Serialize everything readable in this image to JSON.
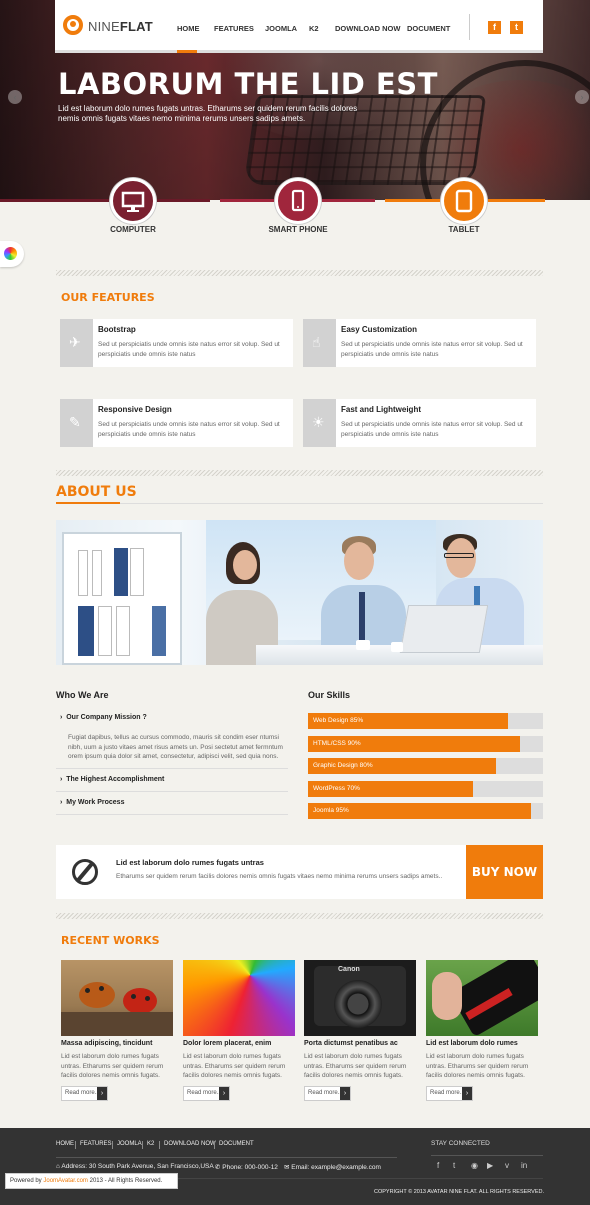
{
  "header": {
    "logo_prefix": "NINE",
    "logo_suffix": "FLAT",
    "nav": [
      "HOME",
      "FEATURES",
      "JOOMLA",
      "K2",
      "DOWNLOAD NOW",
      "DOCUMENT"
    ],
    "social_icons": [
      "facebook-icon",
      "twitter-icon"
    ]
  },
  "hero": {
    "title": "LABORUM THE LID EST",
    "subtitle": "Lid est laborum dolo rumes fugats untras. Etharums ser quidem rerum facilis dolores nemis omnis fugats vitaes nemo minima rerums unsers sadips amets.",
    "devices": [
      {
        "label": "COMPUTER",
        "icon": "monitor-icon",
        "color": "#7a2030"
      },
      {
        "label": "SMART PHONE",
        "icon": "smartphone-icon",
        "color": "#a0263c"
      },
      {
        "label": "TABLET",
        "icon": "tablet-icon",
        "color": "#f07c0c"
      }
    ]
  },
  "features": {
    "title": "OUR FEATURES",
    "items": [
      {
        "title": "Bootstrap",
        "text": "Sed ut perspiciatis unde omnis iste natus error sit volup. Sed ut perspiciatis unde omnis iste natus",
        "icon": "paper-plane-icon"
      },
      {
        "title": "Easy Customization",
        "text": "Sed ut perspiciatis unde omnis iste natus error sit volup. Sed ut perspiciatis unde omnis iste natus",
        "icon": "touch-icon"
      },
      {
        "title": "Responsive Design",
        "text": "Sed ut perspiciatis unde omnis iste natus error sit volup. Sed ut perspiciatis unde omnis iste natus",
        "icon": "brush-icon"
      },
      {
        "title": "Fast and Lightweight",
        "text": "Sed ut perspiciatis unde omnis iste natus error sit volup. Sed ut perspiciatis unde omnis iste natus",
        "icon": "lightbulb-icon"
      }
    ]
  },
  "about": {
    "title": "ABOUT US",
    "who_title": "Who We Are",
    "skills_title": "Our Skills",
    "accordion": [
      {
        "label": "Our Company Mission ?",
        "open": true,
        "text": "Fugiat dapibus, tellus ac cursus commodo, mauris sit condim eser ntumsi nibh, uum a justo vitaes amet risus amets un. Posi sectetut amet fermntum orem ipsum quia dolor sit amet, consectetur, adipisci velit, sed quia nons."
      },
      {
        "label": "The Highest Accomplishment",
        "open": false
      },
      {
        "label": "My Work Process",
        "open": false
      }
    ],
    "skills": [
      {
        "label": "Web Design 85%",
        "value": 85
      },
      {
        "label": "HTML/CSS 90%",
        "value": 90
      },
      {
        "label": "Graphic Design 80%",
        "value": 80
      },
      {
        "label": "WordPress 70%",
        "value": 70
      },
      {
        "label": "Joomla 95%",
        "value": 95
      }
    ]
  },
  "cta": {
    "title": "Lid est laborum dolo rumes fugats untras",
    "text": "Etharums ser quidem rerum facilis dolores nemis omnis fugats vitaes nemo minima rerums unsers sadips amets..",
    "button": "BUY NOW"
  },
  "works": {
    "title": "RECENT WORKS",
    "items": [
      {
        "title": "Massa adipiscing, tincidunt",
        "text": "Lid est laborum dolo rumes fugats untras. Etharums ser quidem rerum facilis dolores nemis omnis fugats.",
        "readmore": "Read more..."
      },
      {
        "title": "Dolor lorem placerat, enim",
        "text": "Lid est laborum dolo rumes fugats untras. Etharums ser quidem rerum facilis dolores nemis omnis fugats.",
        "readmore": "Read more..."
      },
      {
        "title": "Porta dictumst penatibus ac",
        "text": "Lid est laborum dolo rumes fugats untras. Etharums ser quidem rerum facilis dolores nemis omnis fugats.",
        "readmore": "Read more..."
      },
      {
        "title": "Lid est laborum dolo rumes",
        "text": "Lid est laborum dolo rumes fugats untras. Etharums ser quidem rerum facilis dolores nemis omnis fugats.",
        "readmore": "Read more..."
      }
    ]
  },
  "footer": {
    "nav": [
      "HOME",
      "FEATURES",
      "JOOMLA",
      "K2",
      "DOWNLOAD NOW",
      "DOCUMENT"
    ],
    "stay_connected": "STAY CONNECTED",
    "address": "Address: 30 South Park Avenue, San Francisco,USA",
    "phone": "Phone: 000-000-12",
    "email": "Email: example@example.com",
    "social": [
      "f",
      "t",
      "rss",
      "yt",
      "v",
      "in"
    ],
    "copyright": "COPYRIGHT © 2013 AVATAR NINE FLAT. ALL RIGHTS RESERVED.",
    "powered_prefix": "Powered by",
    "powered_link": "JoomAvatar.com",
    "powered_suffix": "2013 - All Rights Reserved."
  },
  "colors": {
    "accent": "#f07c0c",
    "footer": "#333333",
    "background": "#f3f2ed"
  }
}
